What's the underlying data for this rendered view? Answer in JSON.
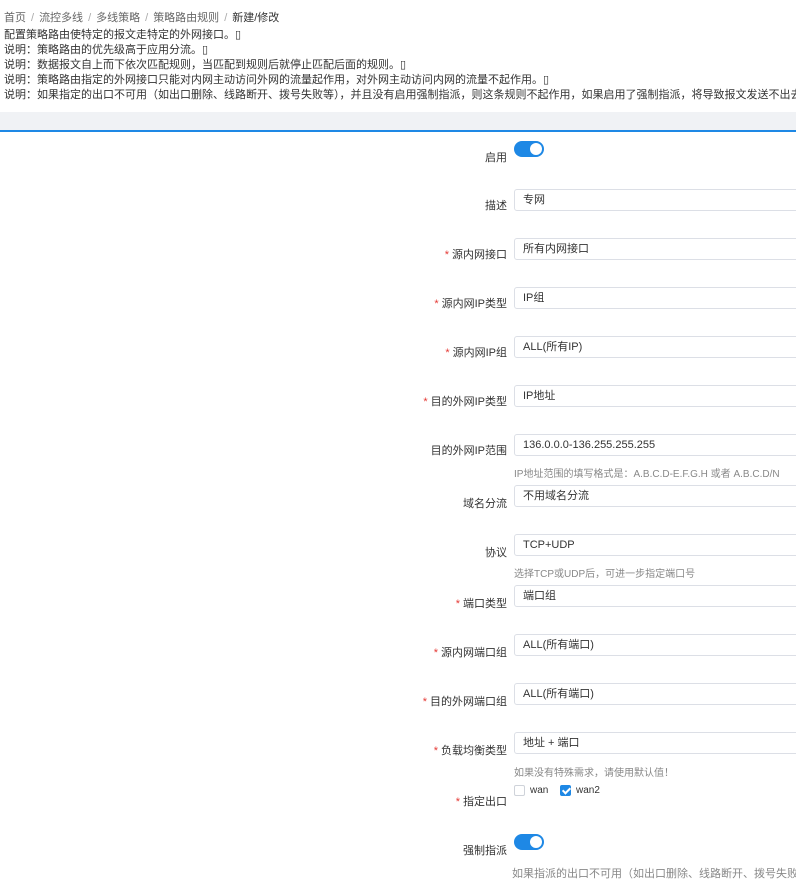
{
  "breadcrumb": {
    "items": [
      "首页",
      "流控多线",
      "多线策略",
      "策略路由规则"
    ],
    "current": "新建/修改"
  },
  "notes": [
    "配置策略路由使特定的报文走特定的外网接口。▯",
    "说明：策略路由的优先级高于应用分流。▯",
    "说明：数据报文自上而下依次匹配规则，当匹配到规则后就停止匹配后面的规则。▯",
    "说明：策略路由指定的外网接口只能对内网主动访问外网的流量起作用，对外网主动访问内网的流量不起作用。▯",
    "说明：如果指定的出口不可用（如出口删除、线路断开、拨号失败等），并且没有启用强制指派，则这条规则不起作用，如果启用了强制指派，将导致报文发送不出去。"
  ],
  "form": {
    "enable": {
      "label": "启用",
      "on": true
    },
    "description": {
      "label": "描述",
      "value": "专网"
    },
    "src_interface": {
      "label": "源内网接口",
      "value": "所有内网接口",
      "required": true
    },
    "src_ip_type": {
      "label": "源内网IP类型",
      "value": "IP组",
      "required": true
    },
    "src_ip_group": {
      "label": "源内网IP组",
      "value": "ALL(所有IP)",
      "required": true
    },
    "dst_ip_type": {
      "label": "目的外网IP类型",
      "value": "IP地址",
      "required": true
    },
    "dst_ip_range": {
      "label": "目的外网IP范围",
      "value": "136.0.0.0-136.255.255.255",
      "hint": "IP地址范围的填写格式是：A.B.C.D-E.F.G.H 或者 A.B.C.D/N"
    },
    "domain_split": {
      "label": "域名分流",
      "value": "不用域名分流"
    },
    "protocol": {
      "label": "协议",
      "value": "TCP+UDP",
      "hint": "选择TCP或UDP后，可进一步指定端口号"
    },
    "port_type": {
      "label": "端口类型",
      "value": "端口组",
      "required": true
    },
    "src_port_group": {
      "label": "源内网端口组",
      "value": "ALL(所有端口)",
      "required": true
    },
    "dst_port_group": {
      "label": "目的外网端口组",
      "value": "ALL(所有端口)",
      "required": true
    },
    "lb_type": {
      "label": "负载均衡类型",
      "value": "地址 + 端口",
      "required": true,
      "hint": "如果没有特殊需求，请使用默认值！"
    },
    "exit": {
      "label": "指定出口",
      "required": true,
      "options": [
        {
          "name": "wan",
          "checked": false
        },
        {
          "name": "wan2",
          "checked": true
        }
      ]
    },
    "force": {
      "label": "强制指派",
      "on": true,
      "hint": "如果指派的出口不可用（如出口删除、线路断开、拨号失败等），"
    }
  },
  "colors": {
    "accent": "#1e88e5",
    "required": "#e53935"
  }
}
